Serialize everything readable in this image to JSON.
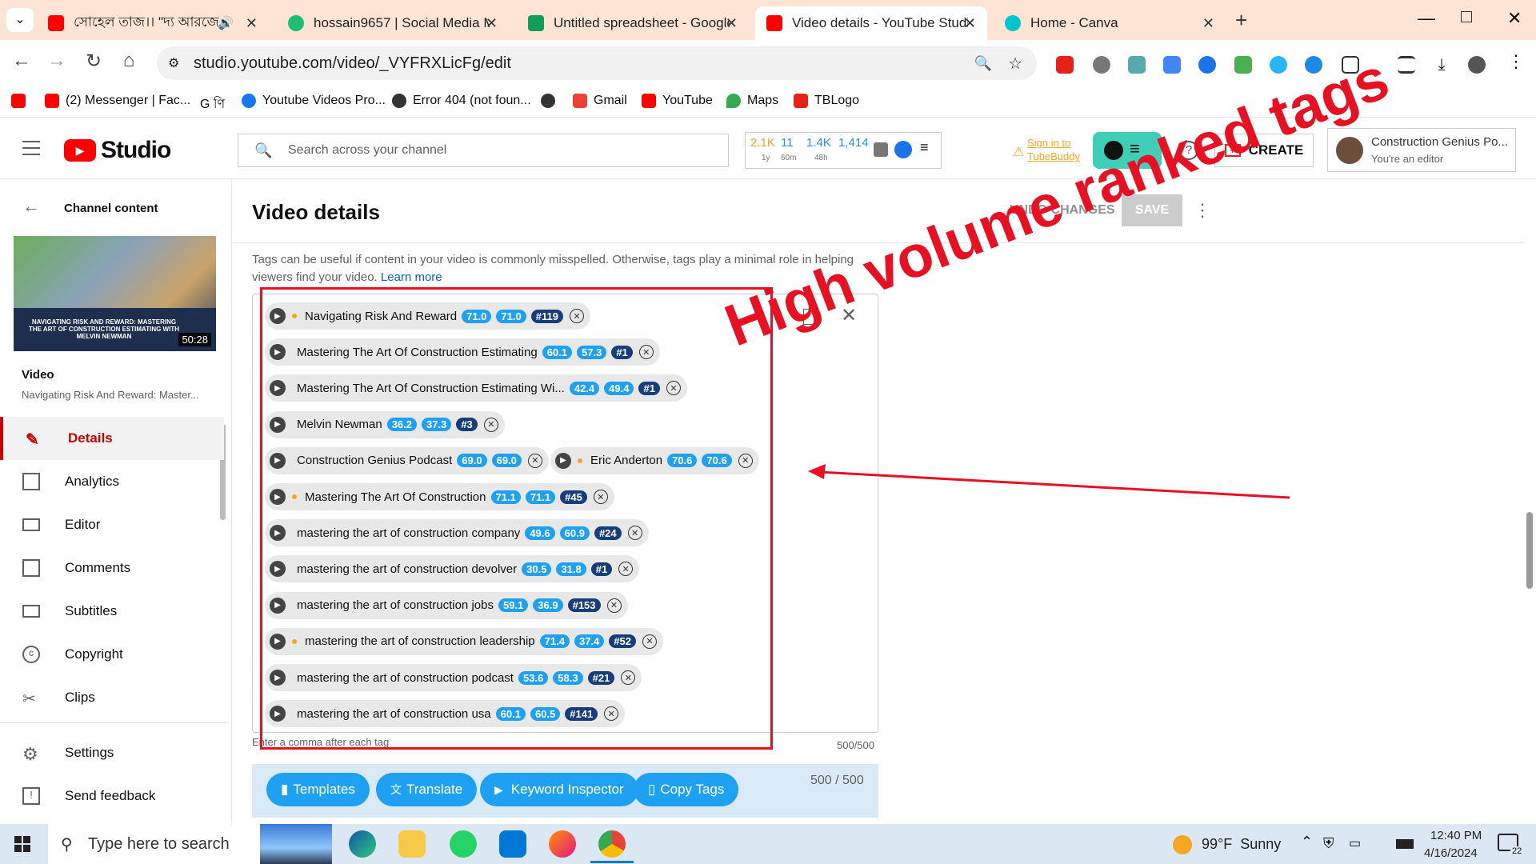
{
  "browser": {
    "tabs": [
      {
        "label": "সোহেল তাজ।। \"দ্য আরজে",
        "icon": "youtube-icon",
        "color": "#ff0000"
      },
      {
        "label": "hossain9657 | Social Media Ma",
        "icon": "fiverr-icon",
        "color": "#1dbf73"
      },
      {
        "label": "Untitled spreadsheet - Google S",
        "icon": "sheets-icon",
        "color": "#0f9d58"
      },
      {
        "label": "Video details - YouTube Studio",
        "icon": "youtube-icon",
        "color": "#ff0000"
      },
      {
        "label": "Home - Canva",
        "icon": "canva-icon",
        "color": "#00c4cc"
      }
    ],
    "url": "studio.youtube.com/video/_VYFRXLicFg/edit",
    "bookmarks": [
      {
        "label": "",
        "icon": "youtube-icon",
        "color": "#ff0000"
      },
      {
        "label": "(2) Messenger | Fac...",
        "icon": "youtube-icon",
        "color": "#ff0000"
      },
      {
        "label": "G ণি",
        "icon": "google-icon",
        "color": "#4285f4"
      },
      {
        "label": "Youtube Videos Pro...",
        "icon": "facebook-icon",
        "color": "#1877f2"
      },
      {
        "label": "Error 404 (not foun...",
        "icon": "globe-icon",
        "color": "#333333"
      },
      {
        "label": "",
        "icon": "globe-icon",
        "color": "#333333"
      },
      {
        "label": "Gmail",
        "icon": "gmail-icon",
        "color": "#ea4335"
      },
      {
        "label": "YouTube",
        "icon": "youtube-icon",
        "color": "#ff0000"
      },
      {
        "label": "Maps",
        "icon": "maps-icon",
        "color": "#34a853"
      },
      {
        "label": "TBLogo",
        "icon": "tubebuddy-icon",
        "color": "#e62117"
      }
    ]
  },
  "studio": {
    "logo_text": "Studio",
    "search_placeholder": "Search across your channel",
    "stats": [
      {
        "value": "2.1K",
        "sub": "1y",
        "color": "#f5a623"
      },
      {
        "value": "11",
        "sub": "60m",
        "color": "#2b8fdd"
      },
      {
        "value": "1.4K",
        "sub": "48h",
        "color": "#2b8fdd"
      },
      {
        "value": "1,414",
        "sub": "",
        "color": "#2b8fdd"
      }
    ],
    "tubebuddy_signin": "Sign in to TubeBuddy",
    "create_label": "CREATE",
    "account_name": "Construction Genius Po...",
    "account_role": "You're an editor"
  },
  "sidebar": {
    "back_label": "Channel content",
    "thumbnail_title": "NAVIGATING RISK AND REWARD: MASTERING THE ART OF CONSTRUCTION ESTIMATING WITH MELVIN NEWMAN",
    "thumbnail_duration": "50:28",
    "video_heading": "Video",
    "video_title": "Navigating Risk And Reward: Master...",
    "items": [
      {
        "label": "Details",
        "icon": "pencil-icon"
      },
      {
        "label": "Analytics",
        "icon": "analytics-icon"
      },
      {
        "label": "Editor",
        "icon": "editor-icon"
      },
      {
        "label": "Comments",
        "icon": "comments-icon"
      },
      {
        "label": "Subtitles",
        "icon": "subtitles-icon"
      },
      {
        "label": "Copyright",
        "icon": "copyright-icon"
      },
      {
        "label": "Clips",
        "icon": "scissors-icon"
      },
      {
        "label": "Settings",
        "icon": "gear-icon"
      },
      {
        "label": "Send feedback",
        "icon": "feedback-icon"
      }
    ]
  },
  "main": {
    "page_title": "Video details",
    "undo_label": "UNDO CHANGES",
    "save_label": "SAVE",
    "tags_help": "Tags can be useful if content in your video is commonly misspelled. Otherwise, tags play a minimal role in helping viewers find your video.",
    "learn_more": "Learn more",
    "tags": [
      {
        "text": "Navigating Risk And Reward",
        "a": "71.0",
        "b": "71.0",
        "rank": "#119",
        "dot": true
      },
      {
        "text": "Mastering The Art Of Construction Estimating",
        "a": "60.1",
        "b": "57.3",
        "rank": "#1",
        "dot": false
      },
      {
        "text": "Mastering The Art Of Construction Estimating Wi...",
        "a": "42.4",
        "b": "49.4",
        "rank": "#1",
        "dot": false
      },
      {
        "text": "Melvin Newman",
        "a": "36.2",
        "b": "37.3",
        "rank": "#3",
        "dot": false
      },
      {
        "text": "Construction Genius Podcast",
        "a": "69.0",
        "b": "69.0",
        "rank": "",
        "dot": false
      },
      {
        "text": "Eric Anderton",
        "a": "70.6",
        "b": "70.6",
        "rank": "",
        "dot": true
      },
      {
        "text": "Mastering The Art Of Construction",
        "a": "71.1",
        "b": "71.1",
        "rank": "#45",
        "dot": true
      },
      {
        "text": "mastering the art of construction company",
        "a": "49.6",
        "b": "60.9",
        "rank": "#24",
        "dot": false
      },
      {
        "text": "mastering the art of construction devolver",
        "a": "30.5",
        "b": "31.8",
        "rank": "#1",
        "dot": false
      },
      {
        "text": "mastering the art of construction jobs",
        "a": "59.1",
        "b": "36.9",
        "rank": "#153",
        "dot": false
      },
      {
        "text": "mastering the art of construction leadership",
        "a": "71.4",
        "b": "37.4",
        "rank": "#52",
        "dot": true
      },
      {
        "text": "mastering the art of construction podcast",
        "a": "53.6",
        "b": "58.3",
        "rank": "#21",
        "dot": false
      },
      {
        "text": "mastering the art of construction usa",
        "a": "60.1",
        "b": "60.5",
        "rank": "#141",
        "dot": false
      }
    ],
    "tag_input_hint": "Enter a comma after each tag",
    "tag_count": "500/500",
    "tag_count_2": "500 / 500",
    "buttons": [
      {
        "label": "Templates",
        "icon": "document-icon"
      },
      {
        "label": "Translate",
        "icon": "translate-icon"
      },
      {
        "label": "Keyword Inspector",
        "icon": "play-icon"
      },
      {
        "label": "Copy Tags",
        "icon": "clipboard-icon"
      }
    ]
  },
  "annotation": {
    "text": "High volume ranked tags",
    "color": "#e81123"
  },
  "taskbar": {
    "search_placeholder": "Type here to search",
    "weather": "99°F  Sunny",
    "time": "12:40 PM",
    "date": "4/16/2024",
    "notification_count": "22"
  }
}
